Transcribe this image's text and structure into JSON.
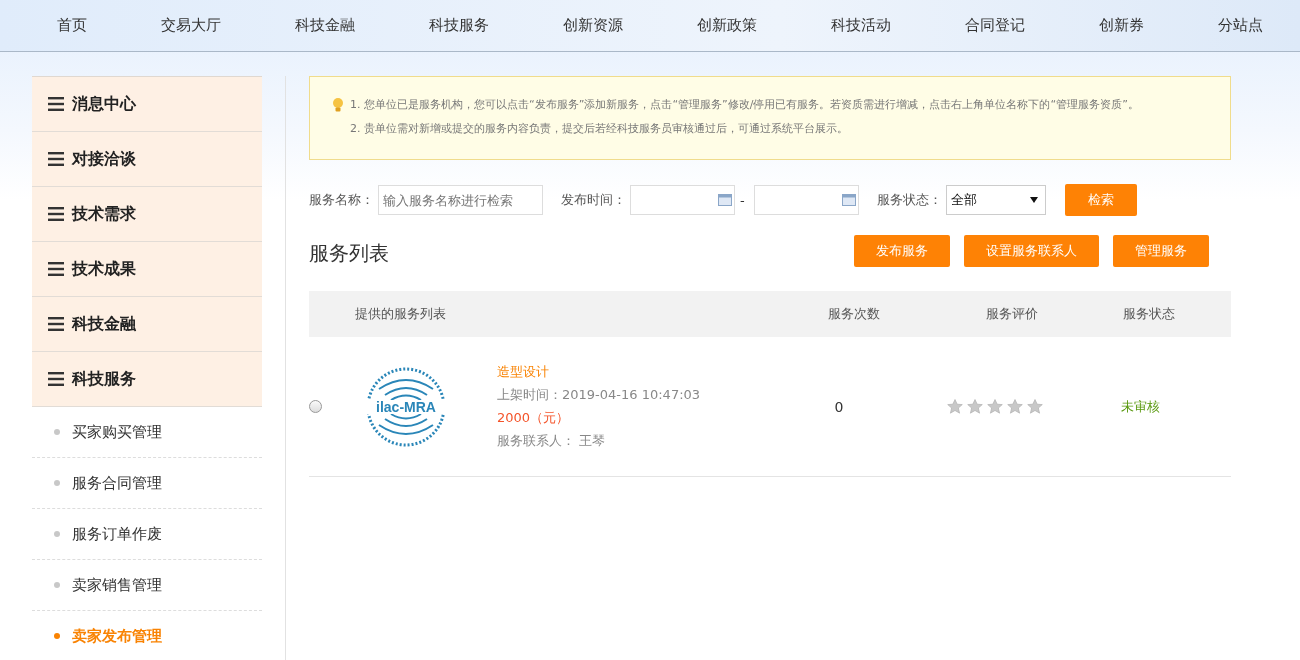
{
  "nav": [
    {
      "label": "首页"
    },
    {
      "label": "交易大厅"
    },
    {
      "label": "科技金融"
    },
    {
      "label": "科技服务"
    },
    {
      "label": "创新资源"
    },
    {
      "label": "创新政策"
    },
    {
      "label": "科技活动"
    },
    {
      "label": "合同登记"
    },
    {
      "label": "创新券"
    },
    {
      "label": "分站点"
    }
  ],
  "sidebar": {
    "groups": [
      {
        "label": "消息中心"
      },
      {
        "label": "对接洽谈"
      },
      {
        "label": "技术需求"
      },
      {
        "label": "技术成果"
      },
      {
        "label": "科技金融"
      },
      {
        "label": "科技服务",
        "children": [
          {
            "label": "买家购买管理",
            "selected": false
          },
          {
            "label": "服务合同管理",
            "selected": false
          },
          {
            "label": "服务订单作废",
            "selected": false
          },
          {
            "label": "卖家销售管理",
            "selected": false
          },
          {
            "label": "卖家发布管理",
            "selected": true
          }
        ]
      }
    ]
  },
  "notice": {
    "lines": [
      "1. 您单位已是服务机构，您可以点击“发布服务”添加新服务，点击“管理服务”修改/停用已有服务。若资质需进行增减，点击右上角单位名称下的“管理服务资质”。",
      "2. 贵单位需对新增或提交的服务内容负责，提交后若经科技服务员审核通过后，可通过系统平台展示。"
    ]
  },
  "filters": {
    "name_label": "服务名称：",
    "name_placeholder": "输入服务名称进行检索",
    "date_label": "发布时间：",
    "date_separator": "-",
    "status_label": "服务状态：",
    "status_value": "全部",
    "search_button": "检索"
  },
  "list": {
    "title": "服务列表",
    "actions": [
      "发布服务",
      "设置服务联系人",
      "管理服务"
    ],
    "columns": [
      "提供的服务列表",
      "服务次数",
      "服务评价",
      "服务状态"
    ],
    "rows": [
      {
        "selected": false,
        "logo_text": "ilac-MRA",
        "name": "造型设计",
        "listed": "上架时间：2019-04-16 10:47:03",
        "price": "2000（元）",
        "contact": "服务联系人： 王琴",
        "count": "0",
        "stars": 0,
        "status": "未审核"
      }
    ]
  }
}
